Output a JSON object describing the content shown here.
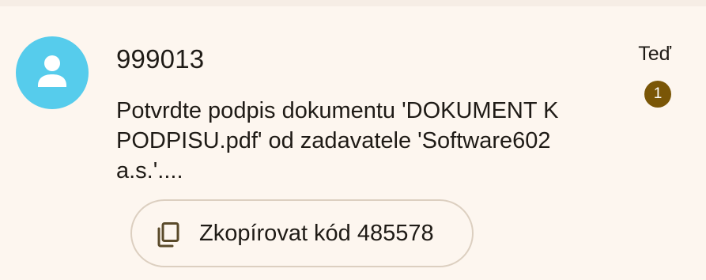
{
  "message": {
    "sender": "999013",
    "time": "Teď",
    "unread_count": "1",
    "preview": "Potvrdte podpis dokumentu 'DOKUMENT K PODPISU.pdf' od zadavatele 'Software602 a.s.'....",
    "avatar_icon": "person-icon",
    "avatar_color": "#56ccec"
  },
  "copy_chip": {
    "icon": "copy-icon",
    "label": "Zkopírovat kód 485578"
  },
  "colors": {
    "background": "#fdf6ef",
    "badge": "#7a5607",
    "text": "#1f1b16"
  }
}
